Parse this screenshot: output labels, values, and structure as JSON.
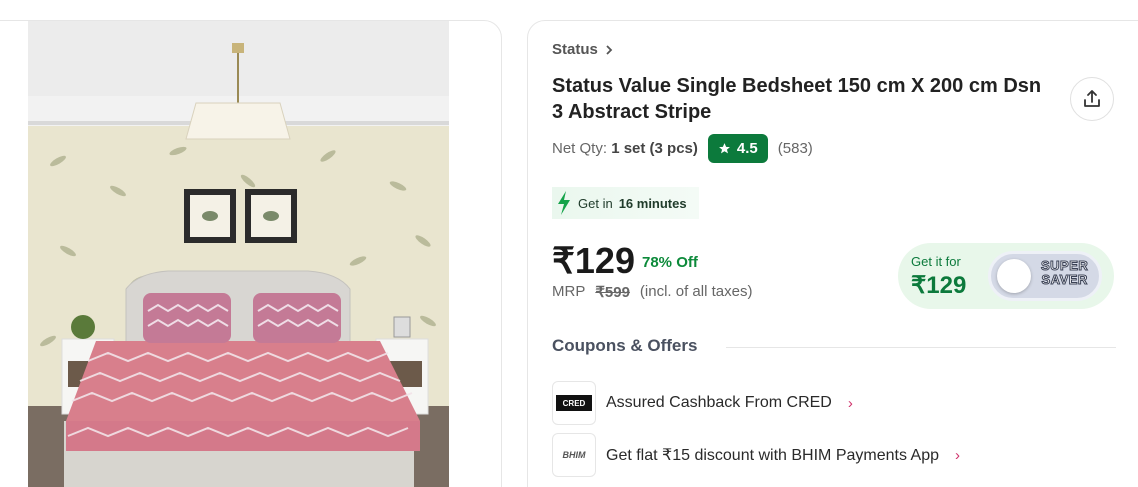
{
  "brand": {
    "label": "Status"
  },
  "product": {
    "title": "Status Value Single Bedsheet 150 cm X 200 cm Dsn 3 Abstract Stripe",
    "net_qty_label": "Net Qty:",
    "net_qty_value": "1 set (3 pcs)",
    "rating": "4.5",
    "rating_count": "(583)"
  },
  "delivery": {
    "prefix": "Get in",
    "time": "16 minutes"
  },
  "pricing": {
    "price": "₹129",
    "discount": "78% Off",
    "mrp_label": "MRP",
    "mrp_value": "₹599",
    "tax_note": "(incl. of all taxes)"
  },
  "super_saver": {
    "label": "Get it for",
    "price": "₹129",
    "badge_line1": "SUPER",
    "badge_line2": "SAVER"
  },
  "offers": {
    "heading": "Coupons & Offers",
    "items": [
      {
        "logo": "CRED",
        "text": "Assured Cashback From CRED"
      },
      {
        "logo": "BHIM",
        "text": "Get flat ₹15 discount with BHIM Payments App"
      }
    ]
  },
  "colors": {
    "green": "#0c7a3c",
    "offer_chevron": "#d0336c"
  },
  "icons": [
    "chevron-right-icon",
    "share-icon",
    "star-icon",
    "lightning-icon"
  ]
}
